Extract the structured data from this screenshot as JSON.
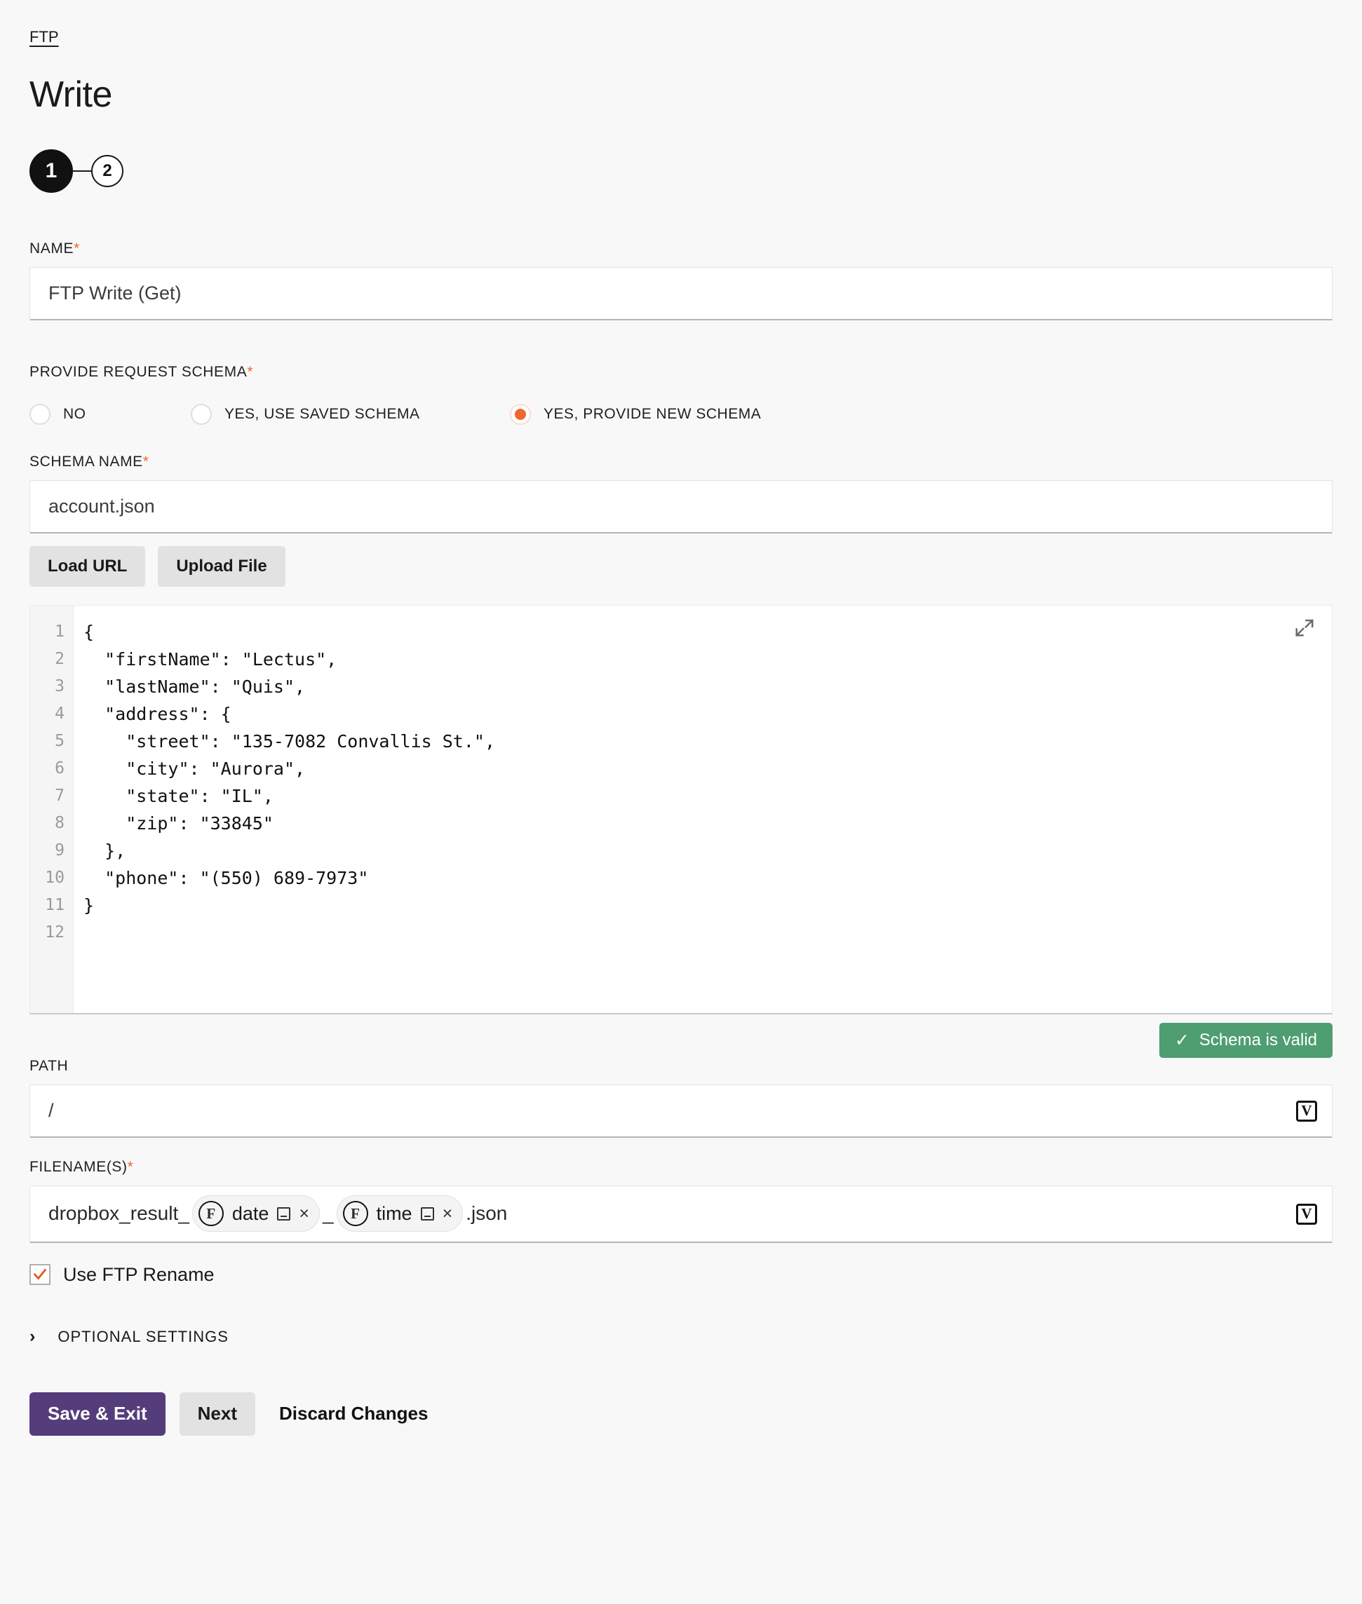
{
  "breadcrumb": {
    "label": "FTP"
  },
  "title": "Write",
  "stepper": {
    "step1": "1",
    "step2": "2"
  },
  "name_field": {
    "label": "NAME",
    "required_mark": "*",
    "value": "FTP Write (Get)"
  },
  "provide_request_schema": {
    "label": "PROVIDE REQUEST SCHEMA",
    "required_mark": "*",
    "options": [
      {
        "label": "NO",
        "selected": false
      },
      {
        "label": "YES, USE SAVED SCHEMA",
        "selected": false
      },
      {
        "label": "YES, PROVIDE NEW SCHEMA",
        "selected": true
      }
    ]
  },
  "schema_name": {
    "label": "SCHEMA NAME",
    "required_mark": "*",
    "value": "account.json"
  },
  "schema_buttons": {
    "load_url": "Load URL",
    "upload_file": "Upload File"
  },
  "editor": {
    "line_numbers": [
      "1",
      "2",
      "3",
      "4",
      "5",
      "6",
      "7",
      "8",
      "9",
      "10",
      "11",
      "12"
    ],
    "content": "{\n  \"firstName\": \"Lectus\",\n  \"lastName\": \"Quis\",\n  \"address\": {\n    \"street\": \"135-7082 Convallis St.\",\n    \"city\": \"Aurora\",\n    \"state\": \"IL\",\n    \"zip\": \"33845\"\n  },\n  \"phone\": \"(550) 689-7973\"\n}\n",
    "expand_icon": "expand-icon"
  },
  "validation_badge": {
    "check": "✓",
    "text": "Schema is valid",
    "color": "#4f9e72"
  },
  "path_field": {
    "label": "PATH",
    "value": "/",
    "variable_icon": "V"
  },
  "filename_field": {
    "label": "FILENAME(S)",
    "required_mark": "*",
    "prefix": "dropbox_result_",
    "separator": "_",
    "suffix": ".json",
    "variable_icon": "V",
    "tokens": [
      {
        "badge": "F",
        "label": "date",
        "minimize_icon": "minimize-icon",
        "close_icon": "×"
      },
      {
        "badge": "F",
        "label": "time",
        "minimize_icon": "minimize-icon",
        "close_icon": "×"
      }
    ]
  },
  "ftp_rename": {
    "label": "Use FTP Rename",
    "checked": true,
    "check_color": "#e2551f"
  },
  "optional_settings": {
    "chevron": "›",
    "label": "OPTIONAL SETTINGS"
  },
  "footer": {
    "save_exit": "Save & Exit",
    "next": "Next",
    "discard": "Discard Changes",
    "primary_color": "#553c7b"
  }
}
